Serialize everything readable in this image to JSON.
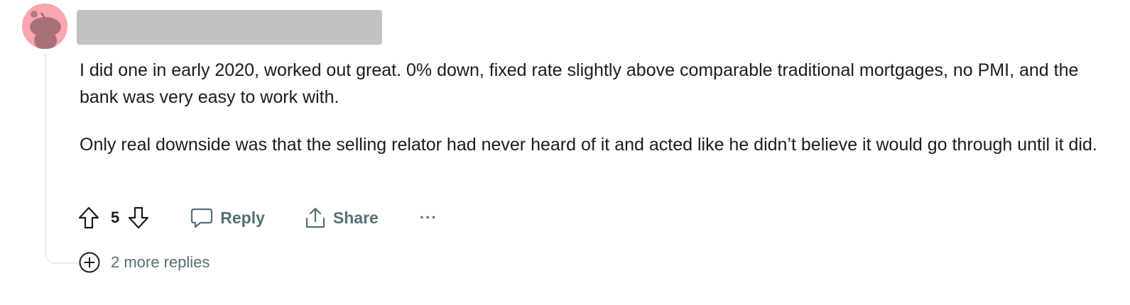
{
  "comment": {
    "author_redacted": true,
    "paragraphs": [
      "I did one in early 2020, worked out great. 0% down, fixed rate slightly above comparable traditional mortgages, no PMI, and the bank was very easy to work with.",
      "Only real downside was that the selling relator had never heard of it and acted like he didn’t believe it would go through until it did."
    ]
  },
  "actions": {
    "vote_count": "5",
    "reply_label": "Reply",
    "share_label": "Share",
    "more_label": "···"
  },
  "replies": {
    "more_label": "2 more replies"
  },
  "icons": {
    "avatar": "snoo-avatar-icon",
    "upvote": "upvote-arrow-icon",
    "downvote": "downvote-arrow-icon",
    "reply": "comment-bubble-icon",
    "share": "share-upload-icon",
    "expand": "plus-circle-icon"
  },
  "colors": {
    "avatar_bg": "#f9a7ae",
    "muted_text": "#576f76",
    "redaction": "#c2c2c2"
  }
}
